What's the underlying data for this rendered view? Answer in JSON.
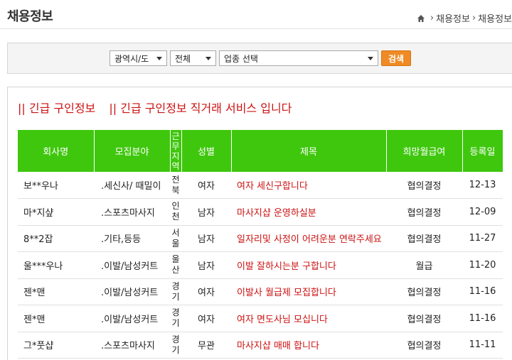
{
  "header": {
    "title": "채용정보",
    "breadcrumb": [
      "채용정보",
      "채용정보"
    ]
  },
  "search": {
    "region_selected": "광역시/도",
    "subregion_selected": "전체",
    "category_selected": "업종 선택",
    "button_label": "검색"
  },
  "notice": [
    "|| 긴급 구인정보",
    "|| 긴급 구인정보 직거래 서비스 입니다"
  ],
  "table": {
    "headers": [
      "회사명",
      "모집분야",
      "근무지역",
      "성별",
      "제목",
      "희망월급여",
      "등록일"
    ],
    "rows": [
      {
        "company": "보**우나",
        "field": ".세신사/ 때밀이",
        "region": "전북",
        "gender": "여자",
        "title": "여자 세신구합니다",
        "salary": "협의결정",
        "date": "12-13"
      },
      {
        "company": "마*지샾",
        "field": ".스포츠마사지",
        "region": "인천",
        "gender": "남자",
        "title": "마사지샵 운영하실분",
        "salary": "협의결정",
        "date": "12-09"
      },
      {
        "company": "8**2잡",
        "field": ".기타,등등",
        "region": "서울",
        "gender": "남자",
        "title": "일자리및 사정이 어려운분 연락주세요",
        "salary": "협의결정",
        "date": "11-27"
      },
      {
        "company": "울***우나",
        "field": ".이발/남성커트",
        "region": "울산",
        "gender": "남자",
        "title": "이발 잘하시는분 구합니다",
        "salary": "월급",
        "date": "11-20"
      },
      {
        "company": "젠*맨",
        "field": ".이발/남성커트",
        "region": "경기",
        "gender": "여자",
        "title": "이발사 월급제 모집합니다",
        "salary": "협의결정",
        "date": "11-16"
      },
      {
        "company": "젠*맨",
        "field": ".이발/남성커트",
        "region": "경기",
        "gender": "여자",
        "title": "여자 면도사님 모십니다",
        "salary": "협의결정",
        "date": "11-16"
      },
      {
        "company": "그*풋샵",
        "field": ".스포츠마사지",
        "region": "경기",
        "gender": "무관",
        "title": "마사지샵 매매 합니다",
        "salary": "협의결정",
        "date": "11-11"
      }
    ]
  },
  "colors": {
    "header_green": "#3fc70e",
    "accent_red": "#cc1111",
    "button_orange": "#f08a24"
  }
}
